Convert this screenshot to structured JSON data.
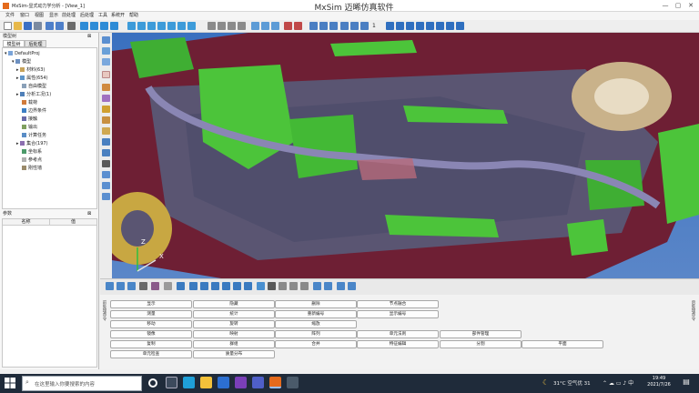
{
  "window": {
    "title_left": "MxSim-显式动力学分析 - [View_1]",
    "title_center": "MxSim 迈晞仿真软件",
    "controls": [
      "—",
      "▢",
      "✕"
    ]
  },
  "menu": [
    "文件",
    "窗口",
    "视图",
    "显示",
    "前处理",
    "后处理",
    "工具",
    "系统开",
    "帮助"
  ],
  "toolbar": {
    "page_number": "1"
  },
  "left_panel": {
    "header": "模型树",
    "tabs": [
      "模型树",
      "后处理"
    ],
    "tree": [
      {
        "label": "DefaultProj",
        "level": 0,
        "icon": "project-icon"
      },
      {
        "label": "模型",
        "level": 1,
        "icon": "model-icon"
      },
      {
        "label": "材料(63)",
        "level": 2,
        "icon": "material-icon"
      },
      {
        "label": "属性(654)",
        "level": 2,
        "icon": "property-icon"
      },
      {
        "label": "自由模型",
        "level": 2,
        "icon": "free-model-icon"
      },
      {
        "label": "分析工况(1)",
        "level": 2,
        "icon": "loadcase-icon"
      },
      {
        "label": "载荷",
        "level": 2,
        "icon": "load-icon"
      },
      {
        "label": "边界条件",
        "level": 2,
        "icon": "boundary-icon"
      },
      {
        "label": "接触",
        "level": 2,
        "icon": "contact-icon"
      },
      {
        "label": "输出",
        "level": 2,
        "icon": "output-icon"
      },
      {
        "label": "计算任务",
        "level": 2,
        "icon": "job-icon"
      },
      {
        "label": "集合(197)",
        "level": 2,
        "icon": "set-icon"
      },
      {
        "label": "坐标系",
        "level": 2,
        "icon": "coord-icon"
      },
      {
        "label": "参考点",
        "level": 2,
        "icon": "refpoint-icon"
      },
      {
        "label": "刚性墙",
        "level": 2,
        "icon": "rigidwall-icon"
      }
    ],
    "params_header": "参数",
    "params_columns": [
      "名称",
      "值"
    ]
  },
  "viewport": {
    "axis_labels": {
      "z": "Z",
      "x": "X"
    }
  },
  "command_panel": {
    "side_label_left": "前处理命令",
    "side_label_right": "后处理命令",
    "rows": [
      [
        "显示",
        "隐藏",
        "删除",
        "节点融合"
      ],
      [
        "测量",
        "统计",
        "重新编号",
        "显示编号"
      ],
      [
        "移动",
        "旋转",
        "缩放"
      ],
      [
        "镜像",
        "映射",
        "阵列",
        "单元法则",
        "部件管理"
      ],
      [
        "复制",
        "群组",
        "合并",
        "特征编辑",
        "分割",
        "平面"
      ],
      [
        "单元检查",
        "质量分布"
      ]
    ]
  },
  "taskbar": {
    "search_placeholder": "在这里输入你要搜索的内容",
    "weather": "31°C 空气优 31",
    "time": "19:49",
    "date": "2021/7/26"
  }
}
